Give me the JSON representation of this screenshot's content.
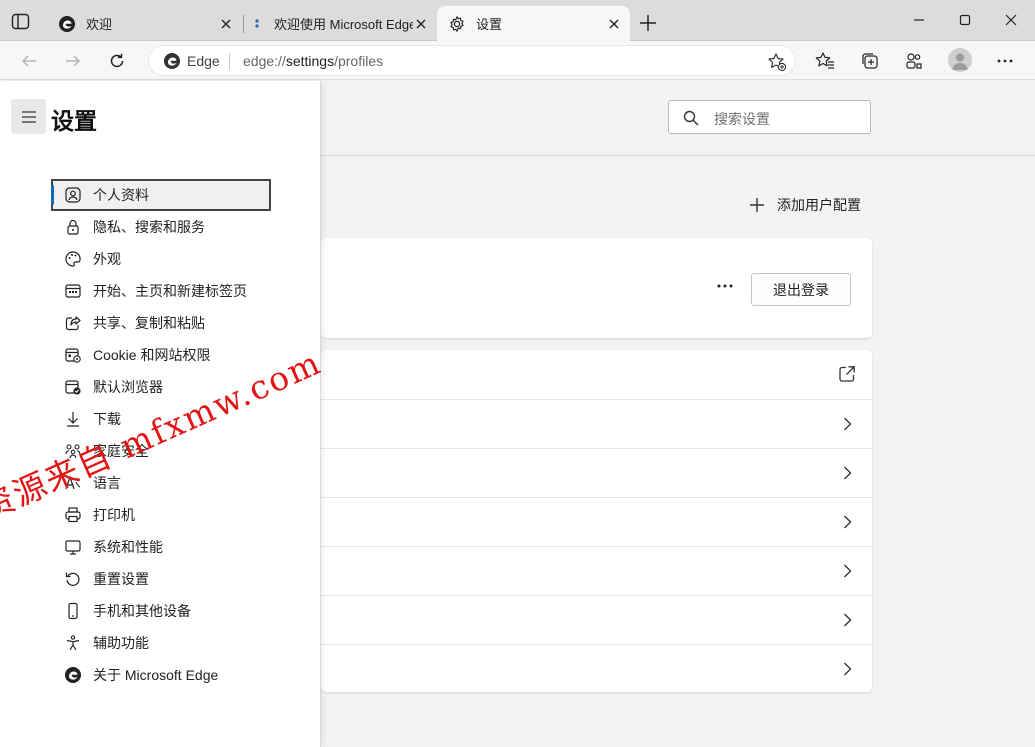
{
  "tabs": [
    {
      "title": "欢迎"
    },
    {
      "title": "欢迎使用 Microsoft Edge"
    },
    {
      "title": "设置"
    }
  ],
  "toolbar": {
    "site_label": "Edge",
    "url_prefix": "edge://",
    "url_path": "settings",
    "url_suffix": "/profiles"
  },
  "search": {
    "placeholder": "搜索设置"
  },
  "settings_nav": {
    "title": "设置",
    "items": [
      {
        "label": "个人资料",
        "icon": "person-icon"
      },
      {
        "label": "隐私、搜索和服务",
        "icon": "lock-icon"
      },
      {
        "label": "外观",
        "icon": "palette-icon"
      },
      {
        "label": "开始、主页和新建标签页",
        "icon": "home-grid-icon"
      },
      {
        "label": "共享、复制和粘贴",
        "icon": "share-icon"
      },
      {
        "label": "Cookie 和网站权限",
        "icon": "site-permissions-icon"
      },
      {
        "label": "默认浏览器",
        "icon": "default-browser-icon"
      },
      {
        "label": "下载",
        "icon": "download-icon"
      },
      {
        "label": "家庭安全",
        "icon": "family-icon"
      },
      {
        "label": "语言",
        "icon": "language-icon"
      },
      {
        "label": "打印机",
        "icon": "printer-icon"
      },
      {
        "label": "系统和性能",
        "icon": "system-icon"
      },
      {
        "label": "重置设置",
        "icon": "reset-icon"
      },
      {
        "label": "手机和其他设备",
        "icon": "phone-icon"
      },
      {
        "label": "辅助功能",
        "icon": "accessibility-icon"
      },
      {
        "label": "关于 Microsoft Edge",
        "icon": "edge-logo-icon"
      }
    ]
  },
  "main": {
    "add_profile_label": "添加用户配置",
    "sign_out_label": "退出登录"
  },
  "watermark": "资源来自 mfxmw.com",
  "colors": {
    "accent": "#0f6cbd",
    "watermark": "#e41414"
  }
}
